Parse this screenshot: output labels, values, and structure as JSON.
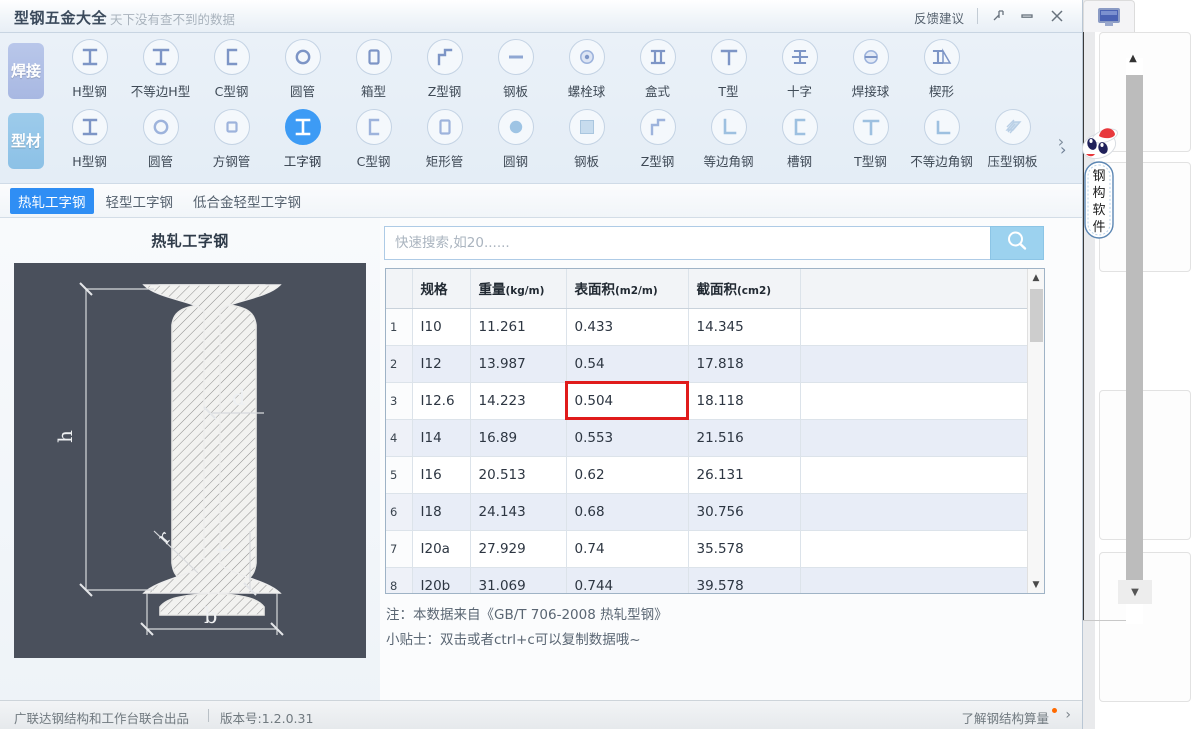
{
  "titlebar": {
    "brand": "型钢五金大全",
    "slogan": "天下没有查不到的数据",
    "feedback": "反馈建议",
    "pin_icon": "pin-icon",
    "minimize_icon": "minimize-icon",
    "close_icon": "close-icon"
  },
  "categories": [
    {
      "tag": "焊接",
      "items": [
        {
          "label": "H型钢",
          "icon": "h-beam-icon"
        },
        {
          "label": "不等边H型",
          "icon": "unequal-h-beam-icon"
        },
        {
          "label": "C型钢",
          "icon": "c-channel-icon"
        },
        {
          "label": "圆管",
          "icon": "round-tube-icon"
        },
        {
          "label": "箱型",
          "icon": "box-section-icon"
        },
        {
          "label": "Z型钢",
          "icon": "z-section-icon"
        },
        {
          "label": "钢板",
          "icon": "steel-plate-icon"
        },
        {
          "label": "螺栓球",
          "icon": "bolt-ball-icon"
        },
        {
          "label": "盒式",
          "icon": "cassette-icon"
        },
        {
          "label": "T型",
          "icon": "t-section-icon"
        },
        {
          "label": "十字",
          "icon": "cross-section-icon"
        },
        {
          "label": "焊接球",
          "icon": "welded-ball-icon"
        },
        {
          "label": "楔形",
          "icon": "wedge-icon"
        }
      ]
    },
    {
      "tag": "型材",
      "items": [
        {
          "label": "H型钢",
          "icon": "h-beam-icon"
        },
        {
          "label": "圆管",
          "icon": "round-tube-icon"
        },
        {
          "label": "方钢管",
          "icon": "square-tube-icon"
        },
        {
          "label": "工字钢",
          "icon": "i-beam-icon"
        },
        {
          "label": "C型钢",
          "icon": "c-channel-icon"
        },
        {
          "label": "矩形管",
          "icon": "rect-tube-icon"
        },
        {
          "label": "圆钢",
          "icon": "round-bar-icon"
        },
        {
          "label": "钢板",
          "icon": "steel-plate-icon"
        },
        {
          "label": "Z型钢",
          "icon": "z-section-icon"
        },
        {
          "label": "等边角钢",
          "icon": "equal-angle-icon"
        },
        {
          "label": "槽钢",
          "icon": "channel-icon"
        },
        {
          "label": "T型钢",
          "icon": "t-bar-icon"
        },
        {
          "label": "不等边角钢",
          "icon": "unequal-angle-icon"
        },
        {
          "label": "压型钢板",
          "icon": "profiled-plate-icon"
        }
      ],
      "active_index": 3,
      "more_icon": "chevron-right-icon"
    }
  ],
  "subtabs": [
    {
      "label": "热轧工字钢",
      "active": true
    },
    {
      "label": "轻型工字钢",
      "active": false
    },
    {
      "label": "低合金轻型工字钢",
      "active": false
    }
  ],
  "diagram": {
    "title": "热轧工字钢",
    "labels": {
      "h": "h",
      "b": "b",
      "d": "d",
      "t": "t",
      "r": "r"
    },
    "background_color": "#4a505c"
  },
  "search": {
    "placeholder": "快速搜索,如20......",
    "value": "",
    "button_icon": "search-icon"
  },
  "table": {
    "columns": [
      "",
      "规格",
      "重量(kg/m)",
      "表面积(m2/m)",
      "截面积(cm2)",
      ""
    ],
    "column_units": {
      "weight": "(kg/m)",
      "surface": "(m2/m)",
      "section": "(cm2)"
    },
    "column_titles": {
      "spec": "规格",
      "weight": "重量",
      "surface": "表面积",
      "section": "截面积"
    },
    "highlight": {
      "row": 3,
      "column": "surface",
      "color": "#e01b1b"
    },
    "rows": [
      {
        "idx": "1",
        "spec": "I10",
        "weight": "11.261",
        "surface": "0.433",
        "section": "14.345"
      },
      {
        "idx": "2",
        "spec": "I12",
        "weight": "13.987",
        "surface": "0.54",
        "section": "17.818"
      },
      {
        "idx": "3",
        "spec": "I12.6",
        "weight": "14.223",
        "surface": "0.504",
        "section": "18.118"
      },
      {
        "idx": "4",
        "spec": "I14",
        "weight": "16.89",
        "surface": "0.553",
        "section": "21.516"
      },
      {
        "idx": "5",
        "spec": "I16",
        "weight": "20.513",
        "surface": "0.62",
        "section": "26.131"
      },
      {
        "idx": "6",
        "spec": "I18",
        "weight": "24.143",
        "surface": "0.68",
        "section": "30.756"
      },
      {
        "idx": "7",
        "spec": "I20a",
        "weight": "27.929",
        "surface": "0.74",
        "section": "35.578"
      },
      {
        "idx": "8",
        "spec": "I20b",
        "weight": "31.069",
        "surface": "0.744",
        "section": "39.578"
      }
    ],
    "scrollbar": {
      "up_icon": "chevron-up-icon",
      "down_icon": "chevron-down-icon"
    }
  },
  "notes": {
    "line1": "注：本数据来自《GB/T 706-2008 热轧型钢》",
    "line2": "小贴士：双击或者ctrl+c可以复制数据哦~"
  },
  "footer": {
    "left": "广联达钢结构和工作台联合出品",
    "version": "版本号:1.2.0.31",
    "right_link": "了解钢结构算量",
    "right_arrow": "chevron-right-icon"
  },
  "mascot": {
    "text": "钢构软件",
    "hat_color": "#e8383c"
  },
  "background": {
    "tab_icon": "monitor-icon"
  }
}
